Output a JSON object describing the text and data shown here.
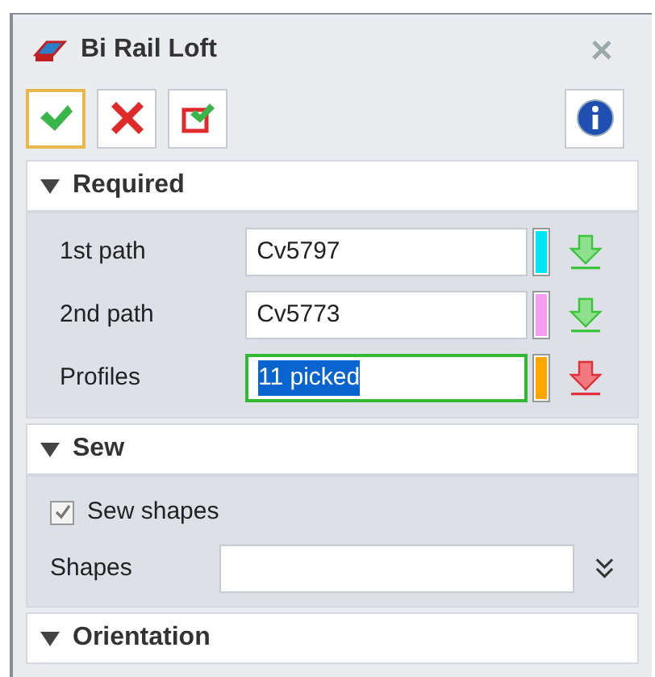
{
  "window": {
    "title": "Bi Rail Loft"
  },
  "toolbar": {
    "buttons": [
      {
        "kind": "ok",
        "selected": true
      },
      {
        "kind": "cancel",
        "selected": false
      },
      {
        "kind": "apply",
        "selected": false
      },
      {
        "kind": "info",
        "selected": false
      }
    ]
  },
  "required": {
    "title": "Required",
    "fields": [
      {
        "label": "1st path",
        "value": "Cv5797",
        "color": "#00e5f5",
        "selected": false
      },
      {
        "label": "2nd path",
        "value": "Cv5773",
        "color": "#f59ef0",
        "selected": false
      },
      {
        "label": "Profiles",
        "value": "11 picked",
        "color": "#ffa500",
        "selected": true
      }
    ]
  },
  "sew": {
    "title": "Sew",
    "checkbox": {
      "label": "Sew shapes",
      "checked": true
    },
    "shapes": {
      "label": "Shapes"
    }
  },
  "orientation": {
    "title": "Orientation"
  }
}
